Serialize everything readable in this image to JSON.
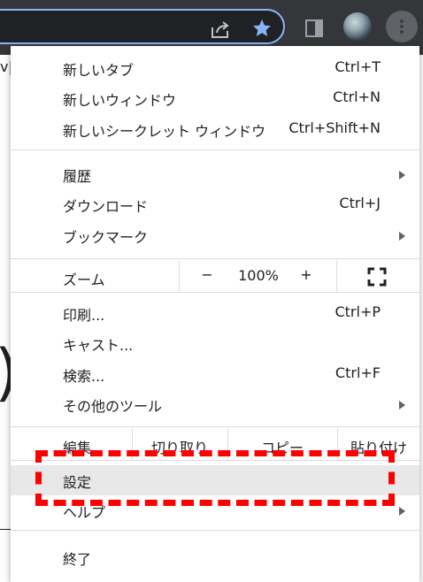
{
  "page": {
    "snippet_text": "v|",
    "large_glyph": ")"
  },
  "toolbar": {
    "share_icon": "share-icon",
    "star_icon": "bookmark-star-icon",
    "side_panel_icon": "side-panel-icon",
    "accent_color": "#8ab4f8"
  },
  "menu": {
    "new_tab": {
      "label": "新しいタブ",
      "shortcut": "Ctrl+T"
    },
    "new_window": {
      "label": "新しいウィンドウ",
      "shortcut": "Ctrl+N"
    },
    "incognito": {
      "label": "新しいシークレット ウィンドウ",
      "shortcut": "Ctrl+Shift+N"
    },
    "history": {
      "label": "履歴"
    },
    "downloads": {
      "label": "ダウンロード",
      "shortcut": "Ctrl+J"
    },
    "bookmarks": {
      "label": "ブックマーク"
    },
    "zoom": {
      "label": "ズーム",
      "minus": "−",
      "value": "100%",
      "plus": "+"
    },
    "print": {
      "label": "印刷...",
      "shortcut": "Ctrl+P"
    },
    "cast": {
      "label": "キャスト..."
    },
    "find": {
      "label": "検索...",
      "shortcut": "Ctrl+F"
    },
    "more_tools": {
      "label": "その他のツール"
    },
    "edit": {
      "label": "編集",
      "cut": "切り取り",
      "copy": "コピー",
      "paste": "貼り付け"
    },
    "settings": {
      "label": "設定"
    },
    "help": {
      "label": "ヘルプ"
    },
    "exit": {
      "label": "終了"
    }
  },
  "annotation": {
    "color": "#ff0000"
  }
}
